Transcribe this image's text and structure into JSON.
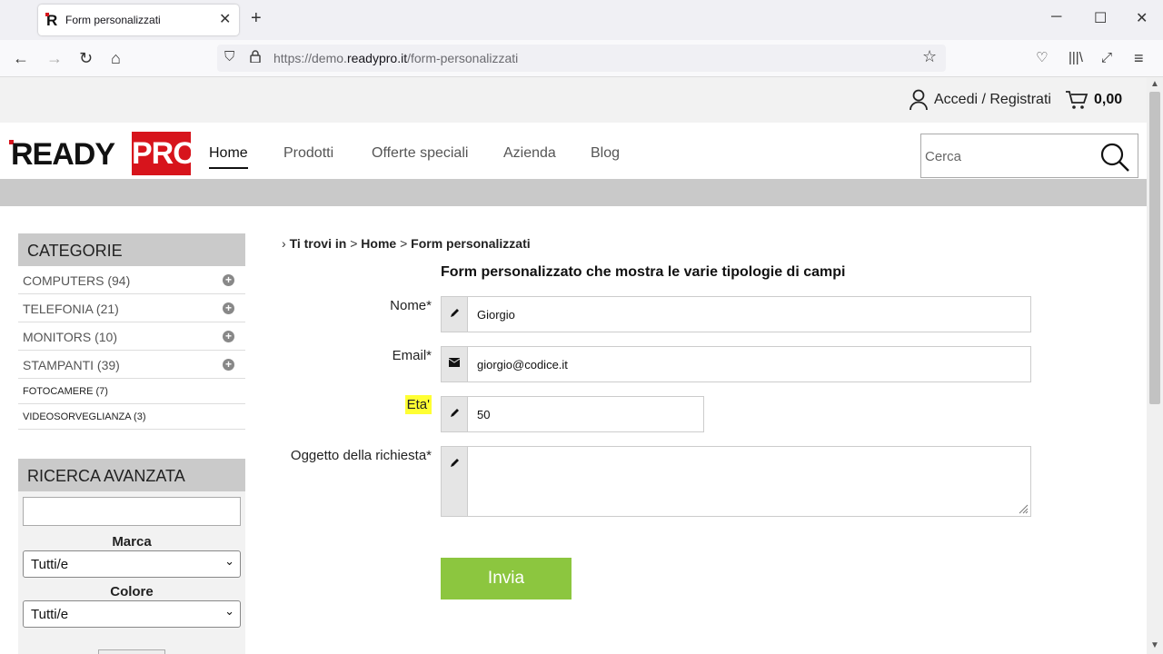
{
  "browser": {
    "tab_title": "Form personalizzati",
    "url_prefix": "https://demo.",
    "url_domain": "readypro.it",
    "url_path": "/form-personalizzati"
  },
  "topbar": {
    "account_label": "Accedi / Registrati",
    "cart_total": "0,00"
  },
  "header": {
    "logo_ready": "READY",
    "logo_pro": "PRO",
    "menu": [
      "Home",
      "Prodotti",
      "Offerte speciali",
      "Azienda",
      "Blog"
    ],
    "search_placeholder": "Cerca"
  },
  "sidebar": {
    "categories_title": "CATEGORIE",
    "categories": [
      {
        "label": "COMPUTERS (94)",
        "expandable": true
      },
      {
        "label": "TELEFONIA (21)",
        "expandable": true
      },
      {
        "label": "MONITORS (10)",
        "expandable": true
      },
      {
        "label": "STAMPANTI (39)",
        "expandable": true
      },
      {
        "label": "FOTOCAMERE (7)",
        "expandable": false
      },
      {
        "label": "VIDEOSORVEGLIANZA (3)",
        "expandable": false
      }
    ],
    "advanced_title": "RICERCA AVANZATA",
    "brand_label": "Marca",
    "brand_value": "Tutti/e",
    "color_label": "Colore",
    "color_value": "Tutti/e"
  },
  "breadcrumb": {
    "prefix": "Ti trovi in",
    "home": "Home",
    "current": "Form personalizzati"
  },
  "form": {
    "title": "Form personalizzato che mostra le varie tipologie di campi",
    "name_label": "Nome*",
    "name_value": "Giorgio",
    "email_label": "Email*",
    "email_value": "giorgio@codice.it",
    "age_label": "Eta'",
    "age_value": "50",
    "subject_label": "Oggetto della richiesta*",
    "subject_value": "",
    "submit_label": "Invia"
  },
  "colors": {
    "brand_red": "#d7141c",
    "submit_green": "#8cc63f",
    "highlight_yellow": "#ffff33"
  }
}
